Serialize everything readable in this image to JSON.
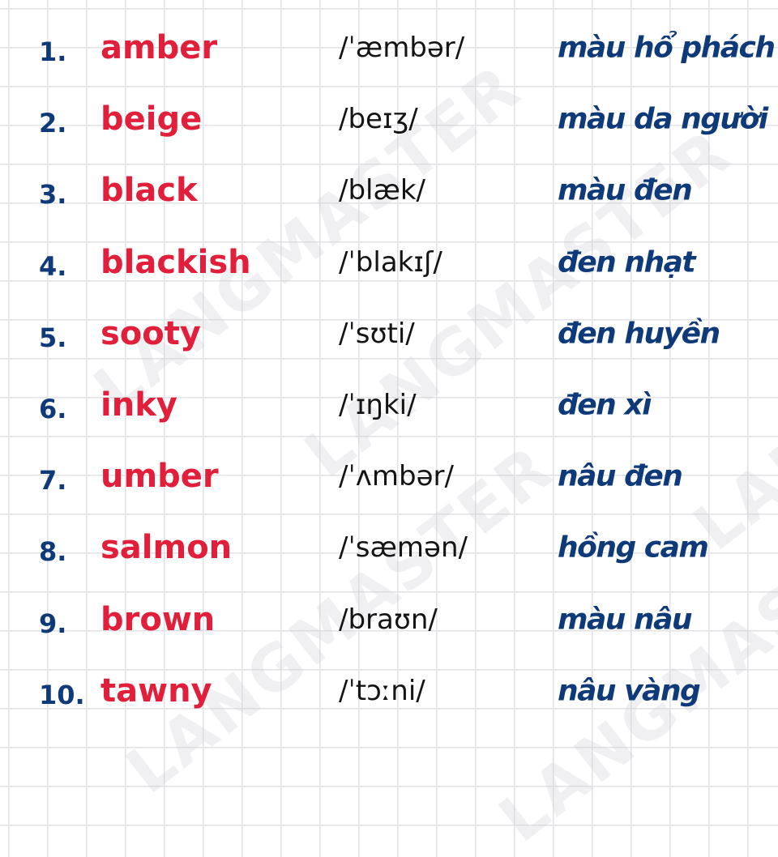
{
  "watermark": "LANGMASTER",
  "colors": {
    "number": "#0f3a7a",
    "word": "#e21f3b",
    "ipa": "#141414",
    "meaning": "#0f3a7a",
    "grid": "#e2e2e6"
  },
  "rows": [
    {
      "number": "1.",
      "word": "amber",
      "ipa": "/ˈæmbər/",
      "meaning": "màu hổ phách"
    },
    {
      "number": "2.",
      "word": "beige",
      "ipa": "/beɪʒ/",
      "meaning": "màu da người"
    },
    {
      "number": "3.",
      "word": "black",
      "ipa": "/blæk/",
      "meaning": "màu đen"
    },
    {
      "number": "4.",
      "word": "blackish",
      "ipa": "/ˈblakɪʃ/",
      "meaning": "đen nhạt"
    },
    {
      "number": "5.",
      "word": "sooty",
      "ipa": "/ˈsʊti/",
      "meaning": "đen huyền"
    },
    {
      "number": "6.",
      "word": "inky",
      "ipa": "/ˈɪŋki/",
      "meaning": "đen xì"
    },
    {
      "number": "7.",
      "word": "umber",
      "ipa": "/ˈʌmbər/",
      "meaning": "nâu đen"
    },
    {
      "number": "8.",
      "word": "salmon",
      "ipa": "/ˈsæmən/",
      "meaning": "hồng cam"
    },
    {
      "number": "9.",
      "word": "brown",
      "ipa": "/braʊn/",
      "meaning": "màu nâu"
    },
    {
      "number": "10.",
      "word": "tawny",
      "ipa": "/ˈtɔːni/",
      "meaning": "nâu vàng"
    }
  ]
}
